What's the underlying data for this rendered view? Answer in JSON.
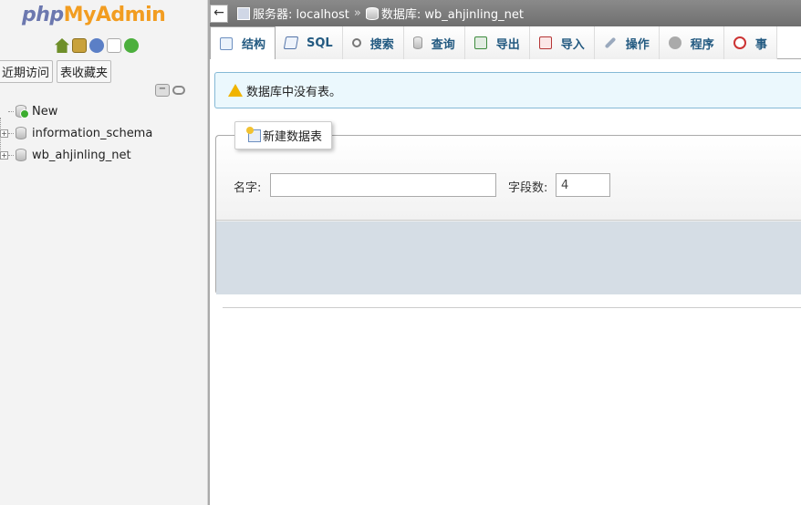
{
  "logo": {
    "php": "php",
    "my": "My",
    "admin": "Admin"
  },
  "nav_icons": [
    "home-icon",
    "logout-icon",
    "help-icon",
    "docs-icon",
    "reload-icon"
  ],
  "nav_tabs": [
    {
      "label": "近期访问"
    },
    {
      "label": "表收藏夹"
    }
  ],
  "tree": [
    {
      "label": "New"
    },
    {
      "label": "information_schema"
    },
    {
      "label": "wb_ahjinling_net"
    }
  ],
  "breadcrumb": {
    "server_label": "服务器: localhost",
    "separator": "»",
    "db_label": "数据库: wb_ahjinling_net"
  },
  "tabs": [
    {
      "label": "结构",
      "icon": "structure-icon"
    },
    {
      "label": "SQL",
      "icon": "sql-icon"
    },
    {
      "label": "搜索",
      "icon": "search-icon"
    },
    {
      "label": "查询",
      "icon": "query-icon"
    },
    {
      "label": "导出",
      "icon": "export-icon"
    },
    {
      "label": "导入",
      "icon": "import-icon"
    },
    {
      "label": "操作",
      "icon": "operations-icon"
    },
    {
      "label": "程序",
      "icon": "routines-icon"
    },
    {
      "label": "事",
      "icon": "events-icon"
    }
  ],
  "notice": {
    "text": "数据库中没有表。"
  },
  "create_table": {
    "legend": "新建数据表",
    "name_label": "名字:",
    "name_value": "",
    "columns_label": "字段数:",
    "columns_value": "4"
  },
  "colors": {
    "topbar": "#7d7d7d",
    "tab_text": "#235a81",
    "notice_bg": "#ebf8fd",
    "panel_bottom": "#d5dde5"
  }
}
